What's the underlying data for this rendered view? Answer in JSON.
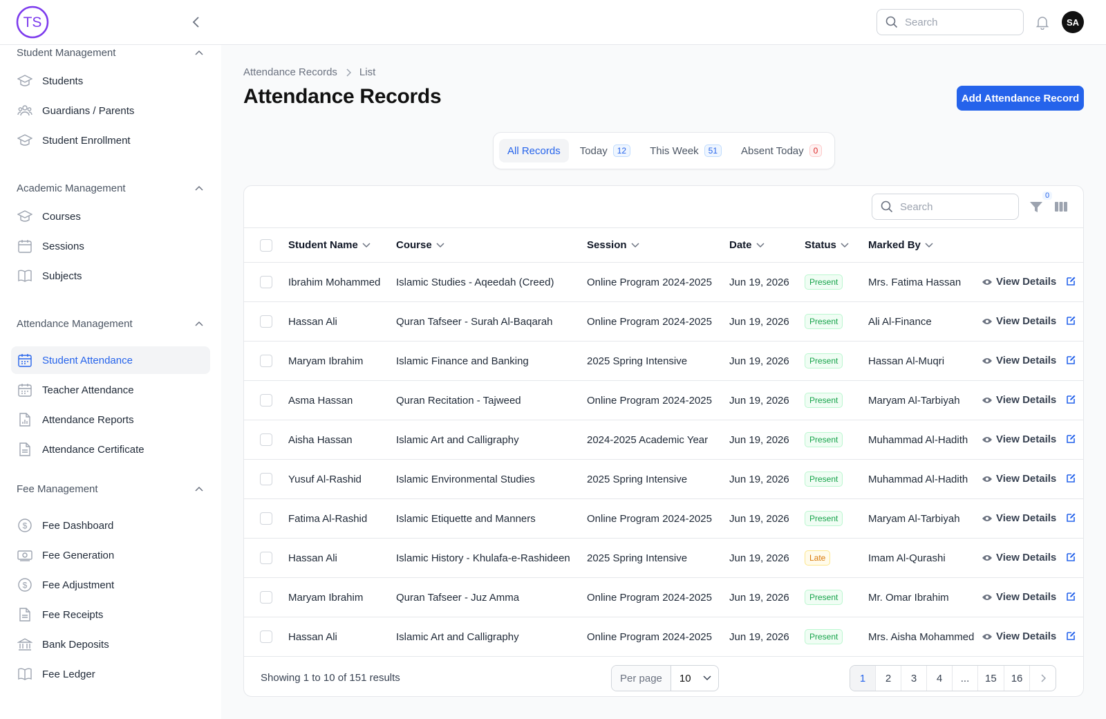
{
  "header": {
    "logo_text": "TS",
    "search_placeholder": "Search",
    "avatar_initials": "SA"
  },
  "sidebar": {
    "groups": [
      {
        "title": "Student Management",
        "items": [
          {
            "label": "Students",
            "icon": "graduation-cap-icon"
          },
          {
            "label": "Guardians / Parents",
            "icon": "users-icon"
          },
          {
            "label": "Student Enrollment",
            "icon": "graduation-cap-icon"
          }
        ]
      },
      {
        "title": "Academic Management",
        "items": [
          {
            "label": "Courses",
            "icon": "graduation-cap-icon"
          },
          {
            "label": "Sessions",
            "icon": "calendar-icon"
          },
          {
            "label": "Subjects",
            "icon": "book-icon"
          }
        ]
      },
      {
        "title": "Attendance Management",
        "items": [
          {
            "label": "Student Attendance",
            "icon": "calendar-days-icon",
            "active": true
          },
          {
            "label": "Teacher Attendance",
            "icon": "calendar-days-icon"
          },
          {
            "label": "Attendance Reports",
            "icon": "chart-document-icon"
          },
          {
            "label": "Attendance Certificate",
            "icon": "document-icon"
          }
        ]
      },
      {
        "title": "Fee Management",
        "items": [
          {
            "label": "Fee Dashboard",
            "icon": "dollar-circle-icon"
          },
          {
            "label": "Fee Generation",
            "icon": "banknote-icon"
          },
          {
            "label": "Fee Adjustment",
            "icon": "dollar-circle-icon"
          },
          {
            "label": "Fee Receipts",
            "icon": "document-icon"
          },
          {
            "label": "Bank Deposits",
            "icon": "bank-icon"
          },
          {
            "label": "Fee Ledger",
            "icon": "book-icon"
          }
        ]
      }
    ]
  },
  "breadcrumb": {
    "parent": "Attendance Records",
    "current": "List"
  },
  "page": {
    "title": "Attendance Records",
    "add_button": "Add Attendance Record"
  },
  "tabs": [
    {
      "label": "All Records",
      "active": true
    },
    {
      "label": "Today",
      "count": "12",
      "badge": "blue"
    },
    {
      "label": "This Week",
      "count": "51",
      "badge": "blue"
    },
    {
      "label": "Absent Today",
      "count": "0",
      "badge": "red"
    }
  ],
  "table": {
    "search_placeholder": "Search",
    "filter_count": "0",
    "columns": [
      "Student Name",
      "Course",
      "Session",
      "Date",
      "Status",
      "Marked By"
    ],
    "view_label": "View Details",
    "rows": [
      {
        "student": "Ibrahim Mohammed",
        "course": "Islamic Studies - Aqeedah (Creed)",
        "session": "Online Program 2024-2025",
        "date": "Jun 19, 2026",
        "status": "Present",
        "marked_by": "Mrs. Fatima Hassan"
      },
      {
        "student": "Hassan Ali",
        "course": "Quran Tafseer - Surah Al-Baqarah",
        "session": "Online Program 2024-2025",
        "date": "Jun 19, 2026",
        "status": "Present",
        "marked_by": "Ali Al-Finance"
      },
      {
        "student": "Maryam Ibrahim",
        "course": "Islamic Finance and Banking",
        "session": "2025 Spring Intensive",
        "date": "Jun 19, 2026",
        "status": "Present",
        "marked_by": "Hassan Al-Muqri"
      },
      {
        "student": "Asma Hassan",
        "course": "Quran Recitation - Tajweed",
        "session": "Online Program 2024-2025",
        "date": "Jun 19, 2026",
        "status": "Present",
        "marked_by": "Maryam Al-Tarbiyah"
      },
      {
        "student": "Aisha Hassan",
        "course": "Islamic Art and Calligraphy",
        "session": "2024-2025 Academic Year",
        "date": "Jun 19, 2026",
        "status": "Present",
        "marked_by": "Muhammad Al-Hadith"
      },
      {
        "student": "Yusuf Al-Rashid",
        "course": "Islamic Environmental Studies",
        "session": "2025 Spring Intensive",
        "date": "Jun 19, 2026",
        "status": "Present",
        "marked_by": "Muhammad Al-Hadith"
      },
      {
        "student": "Fatima Al-Rashid",
        "course": "Islamic Etiquette and Manners",
        "session": "Online Program 2024-2025",
        "date": "Jun 19, 2026",
        "status": "Present",
        "marked_by": "Maryam Al-Tarbiyah"
      },
      {
        "student": "Hassan Ali",
        "course": "Islamic History - Khulafa-e-Rashideen",
        "session": "2025 Spring Intensive",
        "date": "Jun 19, 2026",
        "status": "Late",
        "marked_by": "Imam Al-Qurashi"
      },
      {
        "student": "Maryam Ibrahim",
        "course": "Quran Tafseer - Juz Amma",
        "session": "Online Program 2024-2025",
        "date": "Jun 19, 2026",
        "status": "Present",
        "marked_by": "Mr. Omar Ibrahim"
      },
      {
        "student": "Hassan Ali",
        "course": "Islamic Art and Calligraphy",
        "session": "Online Program 2024-2025",
        "date": "Jun 19, 2026",
        "status": "Present",
        "marked_by": "Mrs. Aisha Mohammed"
      }
    ]
  },
  "footer": {
    "showing": "Showing 1 to 10 of 151 results",
    "per_page_label": "Per page",
    "per_page_value": "10",
    "pages": [
      "1",
      "2",
      "3",
      "4",
      "...",
      "15",
      "16"
    ],
    "current_page": "1"
  },
  "colors": {
    "accent": "#2563eb",
    "present": "#16a34a",
    "late": "#d97706",
    "absent": "#dc2626"
  }
}
